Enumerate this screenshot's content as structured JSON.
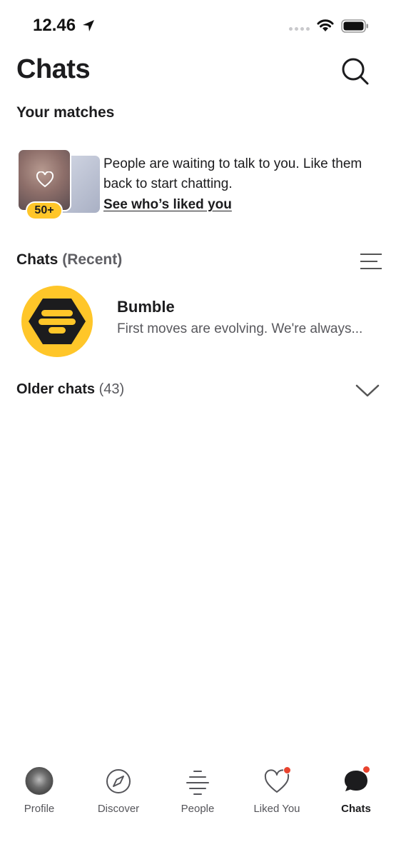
{
  "status_bar": {
    "time": "12.46"
  },
  "header": {
    "title": "Chats",
    "search_icon": "search-icon"
  },
  "matches": {
    "heading": "Your matches",
    "likes_count_badge": "50+",
    "likes_text": "People are waiting to talk to you. Like them back to start chatting.",
    "likes_link": "See who’s liked you"
  },
  "chats_section": {
    "heading": "Chats",
    "heading_qualifier": "(Recent)",
    "filter_icon": "filter-lines-icon"
  },
  "chats": [
    {
      "name": "Bumble",
      "preview": "First moves are evolving. We're always..."
    }
  ],
  "older_chats": {
    "label": "Older chats",
    "count": "(43)",
    "icon": "chevron-down-icon"
  },
  "tabs": [
    {
      "label": "Profile",
      "icon": "avatar",
      "active": false,
      "has_dot": false
    },
    {
      "label": "Discover",
      "icon": "compass-icon",
      "active": false,
      "has_dot": false
    },
    {
      "label": "People",
      "icon": "people-lines-icon",
      "active": false,
      "has_dot": false
    },
    {
      "label": "Liked You",
      "icon": "heart-icon",
      "active": false,
      "has_dot": true
    },
    {
      "label": "Chats",
      "icon": "chat-bubble-icon",
      "active": true,
      "has_dot": true
    }
  ],
  "colors": {
    "brand_yellow": "#ffc629",
    "notification_red": "#e8432e",
    "text_primary": "#1c1c1e",
    "text_secondary": "#58585d"
  }
}
